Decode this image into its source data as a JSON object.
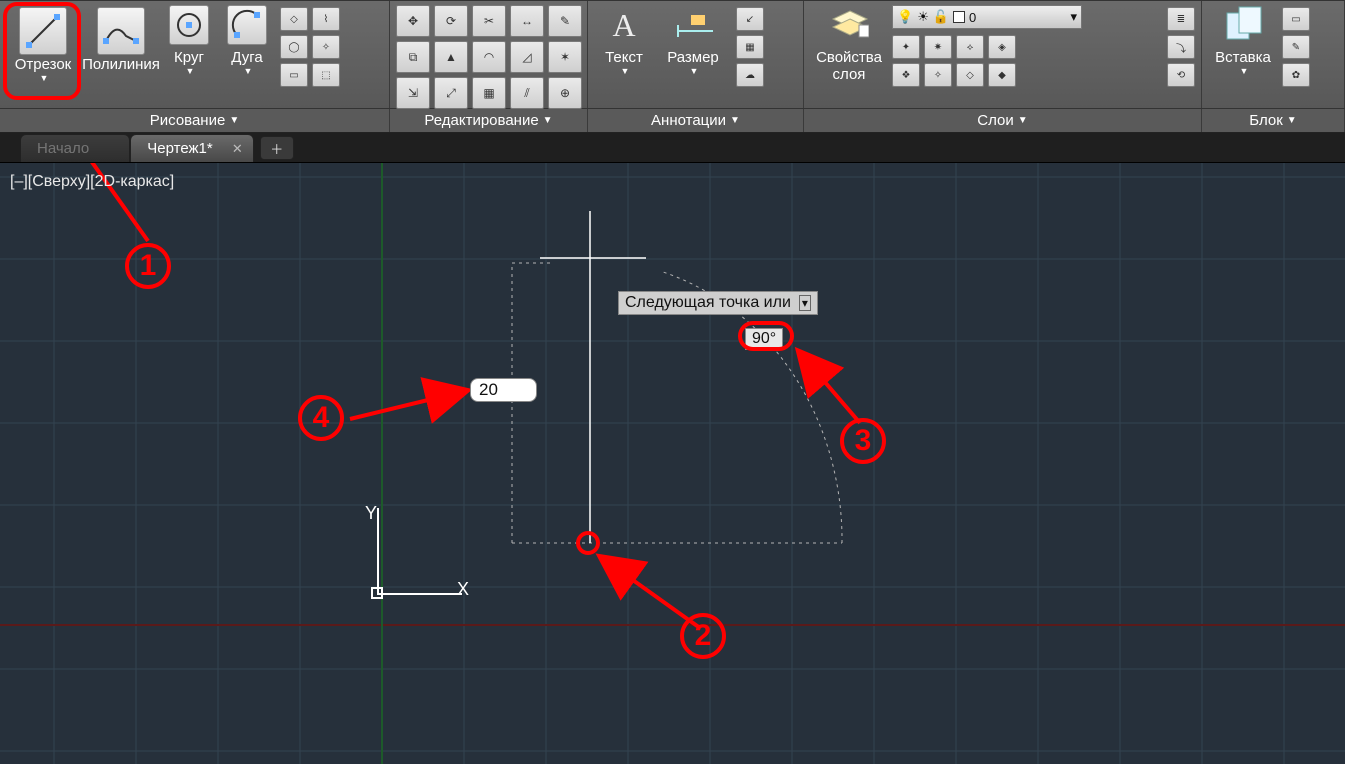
{
  "ribbon": {
    "draw": {
      "line": "Отрезок",
      "polyline": "Полилиния",
      "circle": "Круг",
      "arc": "Дуга",
      "title": "Рисование"
    },
    "modify": {
      "title": "Редактирование"
    },
    "annot": {
      "text": "Текст",
      "dim": "Размер",
      "title": "Аннотации"
    },
    "layers": {
      "props": "Свойства",
      "props2": "слоя",
      "combo_value": "0",
      "title": "Слои"
    },
    "block": {
      "insert": "Вставка",
      "title": "Блок"
    }
  },
  "tabs": {
    "start": "Начало",
    "drawing": "Чертеж1*"
  },
  "viewport_label": "[–][Сверху][2D-каркас]",
  "ucs": {
    "y": "Y",
    "x": "X"
  },
  "tooltip_text": "Следующая точка или",
  "angle_value": "90°",
  "length_value": "20",
  "callouts": {
    "c1": "1",
    "c2": "2",
    "c3": "3",
    "c4": "4"
  }
}
